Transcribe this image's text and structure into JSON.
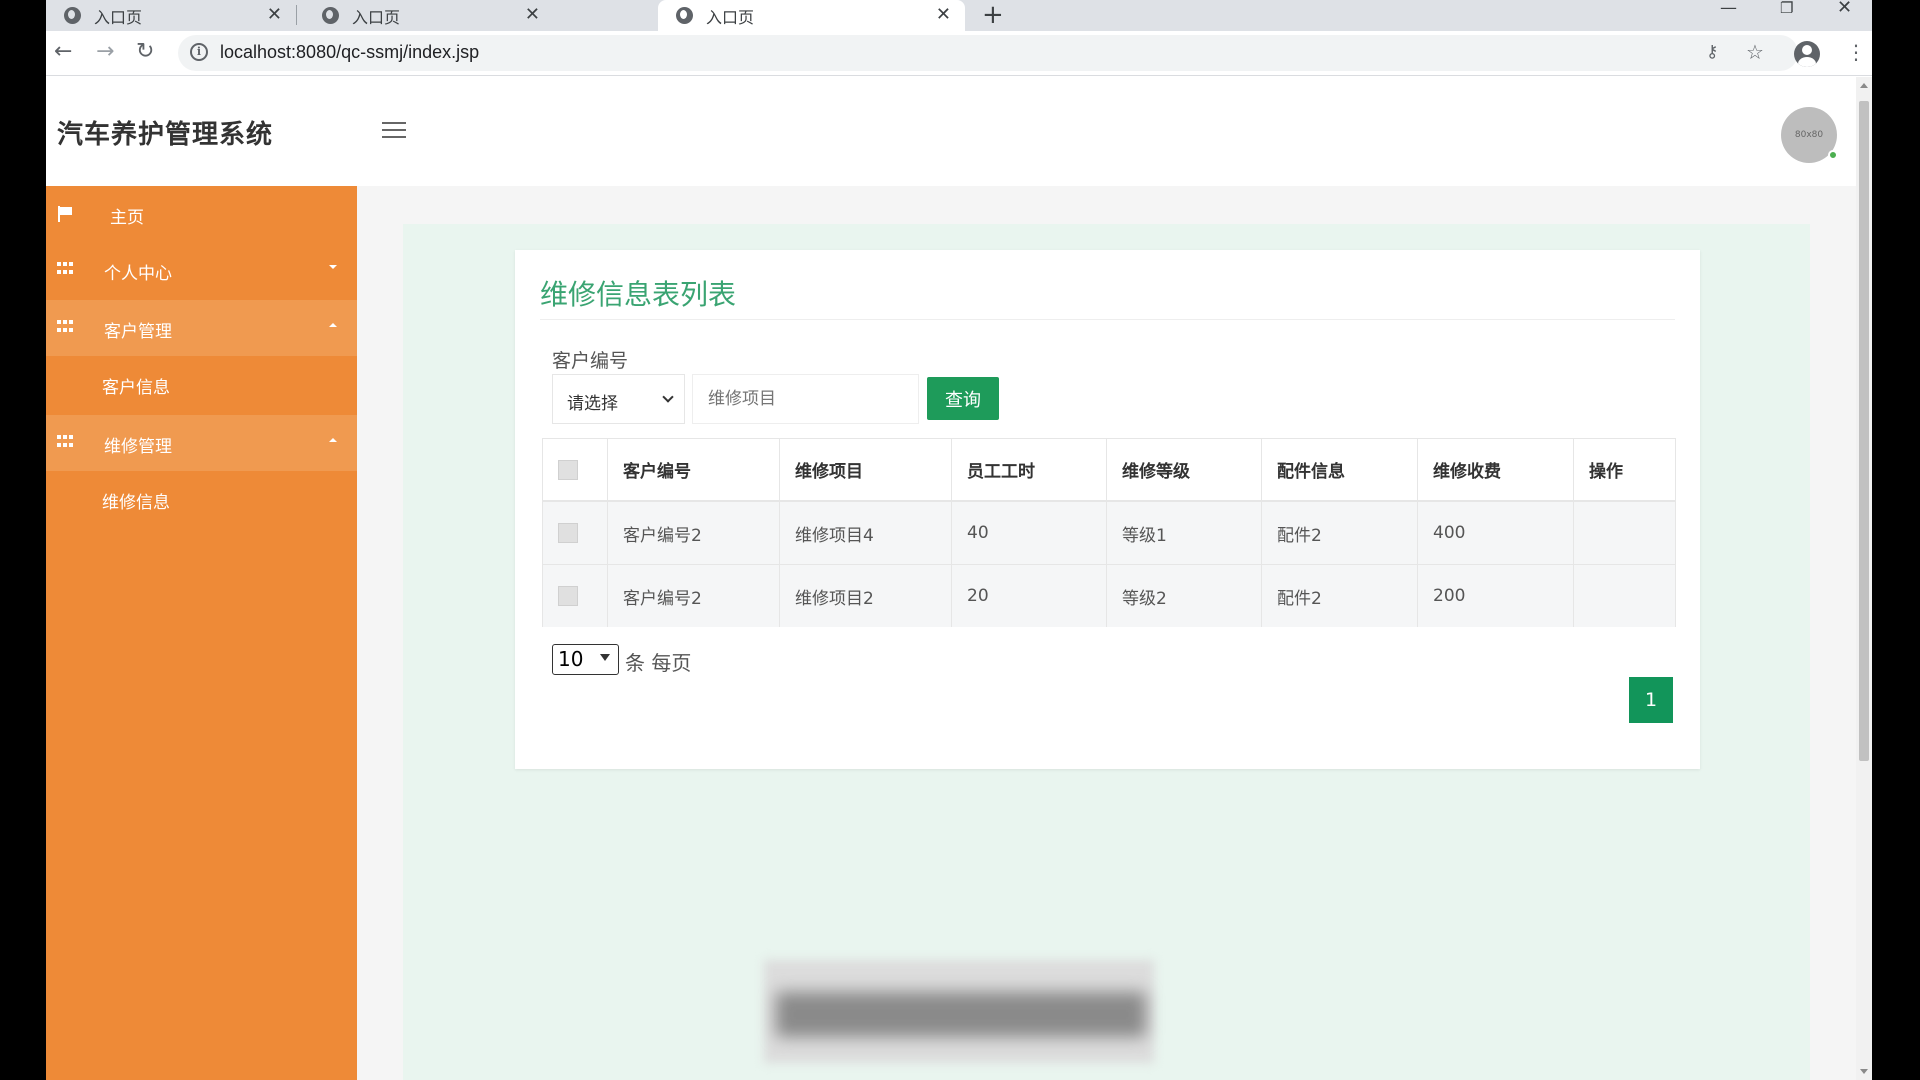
{
  "browser": {
    "tabs": [
      {
        "title": "入口页",
        "active": false
      },
      {
        "title": "入口页",
        "active": false
      },
      {
        "title": "入口页",
        "active": true
      }
    ],
    "url": "localhost:8080/qc-ssmj/index.jsp"
  },
  "header": {
    "title": "汽车养护管理系统",
    "avatar_text": "80x80"
  },
  "sidebar": {
    "home": "主页",
    "personal_center": "个人中心",
    "customer_management": "客户管理",
    "customer_info": "客户信息",
    "repair_management": "维修管理",
    "repair_info": "维修信息"
  },
  "card": {
    "title": "维修信息表列表",
    "filter": {
      "label": "客户编号",
      "select_value": "请选择",
      "input_placeholder": "维修项目",
      "search_label": "查询"
    },
    "table": {
      "headers": [
        "客户编号",
        "维修项目",
        "员工工时",
        "维修等级",
        "配件信息",
        "维修收费",
        "操作"
      ],
      "rows": [
        [
          "客户编号2",
          "维修项目4",
          "40",
          "等级1",
          "配件2",
          "400",
          ""
        ],
        [
          "客户编号2",
          "维修项目2",
          "20",
          "等级2",
          "配件2",
          "200",
          ""
        ]
      ]
    },
    "pagination": {
      "page_size": "10",
      "page_size_label": "条 每页",
      "current_page": "1"
    }
  },
  "colors": {
    "sidebar": "#ee8a37",
    "accent_green": "#1e9b5a",
    "title_green": "#3aa472",
    "content_bg": "#e9f5ef"
  }
}
